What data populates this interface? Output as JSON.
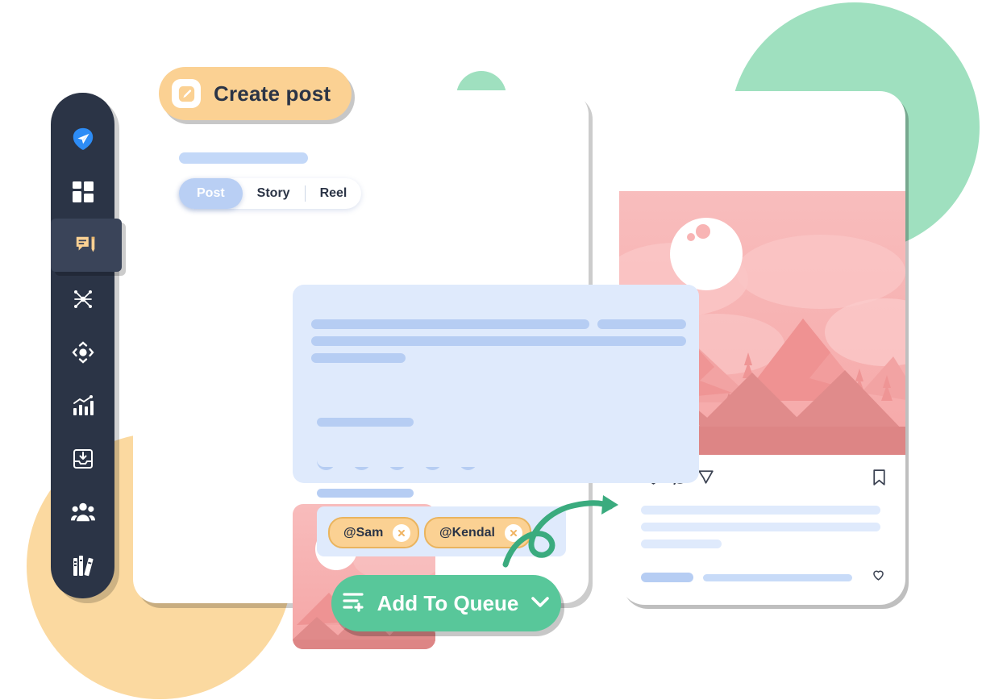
{
  "decor": {
    "green_circle": "#9fe0bf",
    "orange_circle": "#fbd9a0",
    "green_accent": "#58c79a"
  },
  "sidebar": {
    "background": "#2b3446",
    "active_background": "#3a4459",
    "items": [
      {
        "name": "logo",
        "icon": "paper-plane-logo-icon",
        "active": false
      },
      {
        "name": "dashboard",
        "icon": "grid-dashboard-icon",
        "active": false
      },
      {
        "name": "create-post",
        "icon": "chat-pencil-icon",
        "active": true
      },
      {
        "name": "network",
        "icon": "network-hub-icon",
        "active": false
      },
      {
        "name": "navigate",
        "icon": "diamond-nav-icon",
        "active": false
      },
      {
        "name": "analytics",
        "icon": "bar-chart-trend-icon",
        "active": false
      },
      {
        "name": "inbox",
        "icon": "inbox-download-icon",
        "active": false
      },
      {
        "name": "team",
        "icon": "people-group-icon",
        "active": false
      },
      {
        "name": "library",
        "icon": "books-library-icon",
        "active": false
      }
    ]
  },
  "composer": {
    "create_post_button": {
      "label": "Create post",
      "icon": "pencil-square-icon",
      "background": "#fbd193"
    },
    "tabs": [
      {
        "label": "Post",
        "active": true
      },
      {
        "label": "Story",
        "active": false
      },
      {
        "label": "Reel",
        "active": false
      }
    ],
    "editor": {
      "background": "#dfeafc",
      "toolbar_dot_count": 5
    },
    "media_thumbnail": {
      "alt": "pink mountain landscape with sun"
    },
    "tags": [
      {
        "label": "@Sam",
        "close_icon": "close-x-icon"
      },
      {
        "label": "@Kendal",
        "close_icon": "close-x-icon"
      }
    ],
    "queue_button": {
      "label": "Add To Queue",
      "leading_icon": "add-to-queue-icon",
      "trailing_icon": "chevron-down-icon",
      "background": "#58c79a"
    }
  },
  "phone_preview": {
    "menu_icon": "kebab-menu-icon",
    "post_image": {
      "alt": "pink mountain landscape with sun and clouds"
    },
    "actions": [
      {
        "name": "like",
        "icon": "heart-icon"
      },
      {
        "name": "comment",
        "icon": "comment-bubble-icon"
      },
      {
        "name": "share",
        "icon": "send-plane-icon"
      },
      {
        "name": "save",
        "icon": "bookmark-icon"
      }
    ],
    "comment_like_icon": "heart-icon"
  },
  "annotation": {
    "arrow": "curved-loop-arrow",
    "color": "#3aab7e"
  }
}
